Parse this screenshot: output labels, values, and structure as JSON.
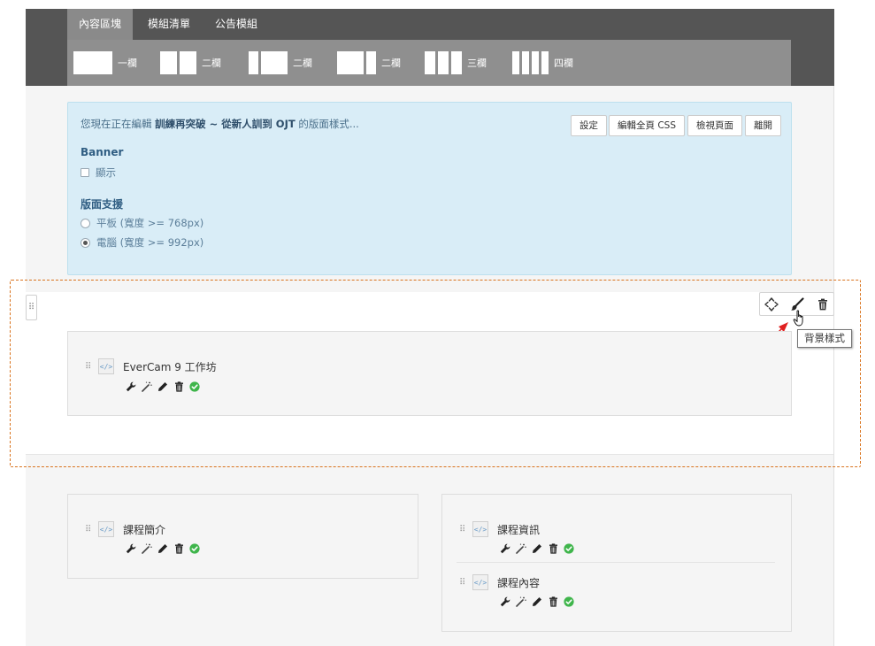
{
  "tabs": [
    {
      "label": "內容區塊",
      "active": true
    },
    {
      "label": "模組清單",
      "active": false
    },
    {
      "label": "公告模組",
      "active": false
    }
  ],
  "layouts": [
    {
      "label": "一欄"
    },
    {
      "label": "二欄"
    },
    {
      "label": "二欄"
    },
    {
      "label": "二欄"
    },
    {
      "label": "三欄"
    },
    {
      "label": "四欄"
    }
  ],
  "info": {
    "editing_prefix": "您現在正在編輯",
    "course_name": "訓練再突破 ~ 從新人訓到 OJT",
    "editing_suffix": "的版面樣式...",
    "buttons": {
      "settings": "設定",
      "edit_css": "編輯全頁 CSS",
      "view_page": "檢視頁面",
      "leave": "離開"
    },
    "banner_title": "Banner",
    "banner_show": "顯示",
    "support_title": "版面支援",
    "tablet": "平板 (寬度 >= 768px)",
    "desktop": "電腦 (寬度 >= 992px)"
  },
  "row_tools": {
    "move_icon": "move-arrows-icon",
    "brush_icon": "paintbrush-icon",
    "delete_icon": "trash-icon",
    "tooltip": "背景樣式"
  },
  "modules": {
    "evercam": "EverCam 9 工作坊",
    "intro": "課程簡介",
    "info": "課程資訊",
    "content": "課程內容"
  },
  "colors": {
    "topbar": "#555555",
    "layout_bar": "#8f8f8f",
    "info_bg": "#d9edf7",
    "dashed_highlight": "#d9731e",
    "annotation_arrow": "#e02020",
    "status_ok": "#3fb54b"
  }
}
